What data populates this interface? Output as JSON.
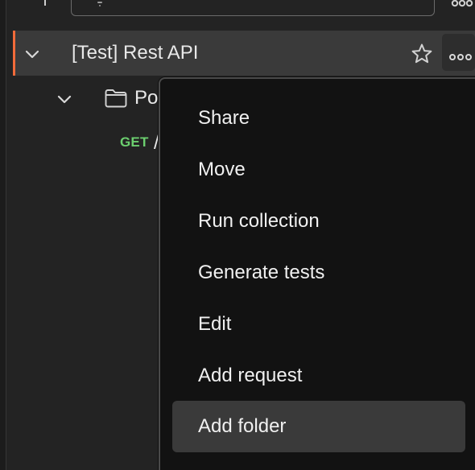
{
  "colors": {
    "background": "#232323",
    "selected_row": "#3a3a3a",
    "accent_bar": "#f26b3a",
    "menu_background": "#121212",
    "menu_hover": "#3a3a3a",
    "get_method": "#6ccf6f",
    "text": "#e8e8e8"
  },
  "top_bar": {
    "add_icon": "plus-icon",
    "filter_icon": "filter-icon",
    "more_icon": "more-horizontal-icon"
  },
  "sidebar": {
    "collection": {
      "chevron_icon": "chevron-down-icon",
      "name": "[Test] Rest API",
      "star_icon": "star-icon",
      "more_icon": "more-horizontal-icon"
    },
    "folder": {
      "chevron_icon": "chevron-down-icon",
      "icon": "folder-icon",
      "name_visible": "Po"
    },
    "request": {
      "method": "GET",
      "path_visible": "/"
    }
  },
  "context_menu": {
    "items": [
      {
        "label": "Share"
      },
      {
        "label": "Move"
      },
      {
        "label": "Run collection"
      },
      {
        "label": "Generate tests"
      },
      {
        "label": "Edit"
      },
      {
        "label": "Add request"
      },
      {
        "label": "Add folder",
        "highlighted": true
      }
    ]
  }
}
